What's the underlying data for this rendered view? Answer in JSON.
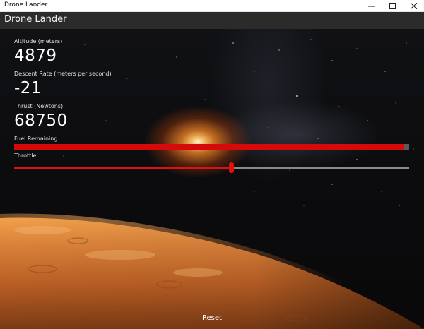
{
  "window": {
    "title": "Drone Lander",
    "controls": {
      "minimize_icon": "minimize-icon",
      "maximize_icon": "maximize-icon",
      "close_icon": "close-icon"
    }
  },
  "app": {
    "title": "Drone Lander"
  },
  "telemetry": {
    "altitude": {
      "label": "Altitude (meters)",
      "value": "4879"
    },
    "descent_rate": {
      "label": "Descent Rate (meters per second)",
      "value": "-21"
    },
    "thrust": {
      "label": "Thrust (Newtons)",
      "value": "68750"
    }
  },
  "fuel": {
    "label": "Fuel Remaining",
    "fraction": 0.988,
    "color": "#d60a0a"
  },
  "throttle": {
    "label": "Throttle",
    "fraction": 0.55,
    "color": "#e01010"
  },
  "reset_label": "Reset"
}
